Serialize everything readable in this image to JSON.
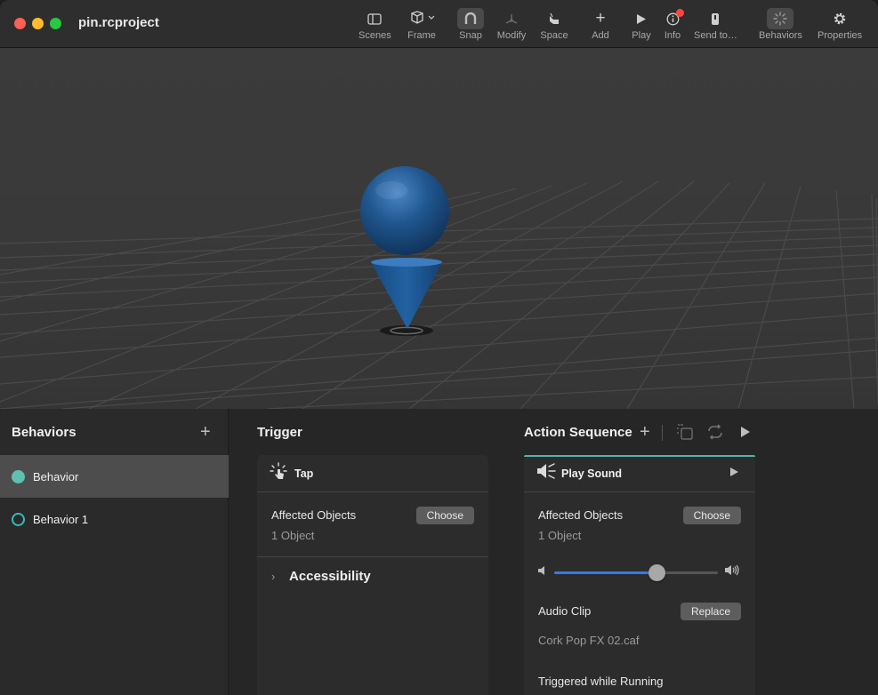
{
  "window": {
    "title": "pin.rcproject"
  },
  "toolbar": {
    "items": [
      {
        "label": "Scenes",
        "icon": "sidebar-icon"
      },
      {
        "label": "Frame",
        "icon": "cube-frame-icon"
      },
      {
        "label": "Snap",
        "icon": "magnet-icon"
      },
      {
        "label": "Modify",
        "icon": "modify-icon"
      },
      {
        "label": "Space",
        "icon": "space-icon"
      },
      {
        "label": "Add",
        "icon": "plus-icon"
      },
      {
        "label": "Play",
        "icon": "play-icon"
      },
      {
        "label": "Info",
        "icon": "info-icon"
      },
      {
        "label": "Send to…",
        "icon": "send-device-icon"
      },
      {
        "label": "Behaviors",
        "icon": "behaviors-icon"
      },
      {
        "label": "Properties",
        "icon": "gear-icon"
      }
    ],
    "info_badge_color": "#ff453a"
  },
  "behaviors": {
    "title": "Behaviors",
    "items": [
      {
        "label": "Behavior",
        "selected": true
      },
      {
        "label": "Behavior 1",
        "selected": false
      }
    ],
    "accent": "#5fbfb0"
  },
  "trigger": {
    "title": "Trigger",
    "card": {
      "name": "Tap",
      "icon": "tap-icon",
      "affected_label": "Affected Objects",
      "affected_value": "1 Object",
      "choose_label": "Choose",
      "accessibility_label": "Accessibility"
    }
  },
  "action_sequence": {
    "title": "Action Sequence",
    "card": {
      "name": "Play Sound",
      "icon": "speaker-icon",
      "affected_label": "Affected Objects",
      "affected_value": "1 Object",
      "choose_label": "Choose",
      "volume": 0.63,
      "audio_clip_label": "Audio Clip",
      "replace_label": "Replace",
      "audio_clip_value": "Cork Pop FX 02.caf",
      "triggered_label": "Triggered while Running"
    },
    "accent": "#4fb7ad",
    "slider_color": "#2f7ee6"
  }
}
